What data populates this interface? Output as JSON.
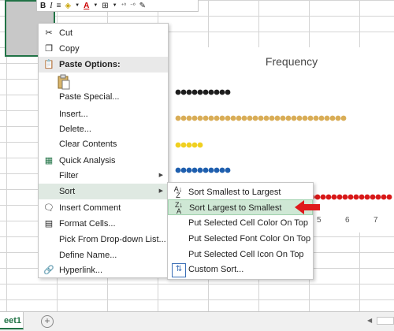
{
  "toolbar": {
    "bold": "B",
    "italic": "I",
    "increase_decimal": ".0\n.00",
    "decrease_decimal": ".00\n.0"
  },
  "chart": {
    "title": "Frequency",
    "ticks": [
      "5",
      "6",
      "7"
    ]
  },
  "context_menu": {
    "cut": "Cut",
    "copy": "Copy",
    "paste_options": "Paste Options:",
    "paste_special": "Paste Special...",
    "insert": "Insert...",
    "delete": "Delete...",
    "clear_contents": "Clear Contents",
    "quick_analysis": "Quick Analysis",
    "filter": "Filter",
    "sort": "Sort",
    "insert_comment": "Insert Comment",
    "format_cells": "Format Cells...",
    "pick_from_dropdown": "Pick From Drop-down List...",
    "define_name": "Define Name...",
    "hyperlink": "Hyperlink..."
  },
  "sort_submenu": {
    "smallest_to_largest": "Sort Smallest to Largest",
    "largest_to_smallest": "Sort Largest to Smallest",
    "cell_color": "Put Selected Cell Color On Top",
    "font_color": "Put Selected Font Color On Top",
    "cell_icon": "Put Selected Cell Icon On Top",
    "custom_sort": "Custom Sort..."
  },
  "sheet_tabs": {
    "active": "eet1",
    "add": "+"
  },
  "colors": {
    "accent": "#217346",
    "highlight": "#cfe8d5",
    "arrow": "#e0191c"
  }
}
